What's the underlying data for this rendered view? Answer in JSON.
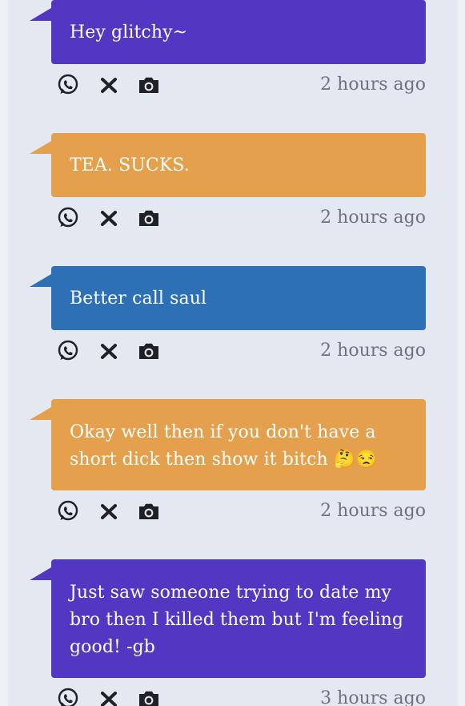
{
  "messages": [
    {
      "text": "Hey glitchy~",
      "time": "2 hours ago",
      "color": "#5137c1"
    },
    {
      "text": "TEA. SUCKS.",
      "time": "2 hours ago",
      "color": "#e4a04c"
    },
    {
      "text": "Better call saul",
      "time": "2 hours ago",
      "color": "#2d70b6"
    },
    {
      "text": "Okay well then if you don't have a short dick then show it bitch 🤔😒",
      "time": "2 hours ago",
      "color": "#e4a04c"
    },
    {
      "text": "Just saw someone trying to date my bro then I killed them but I'm feeling good! -gb",
      "time": "3 hours ago",
      "color": "#5137c1"
    }
  ],
  "actions": {
    "share_icon": "whatsapp-icon",
    "delete_icon": "close-icon",
    "screenshot_icon": "camera-icon"
  }
}
